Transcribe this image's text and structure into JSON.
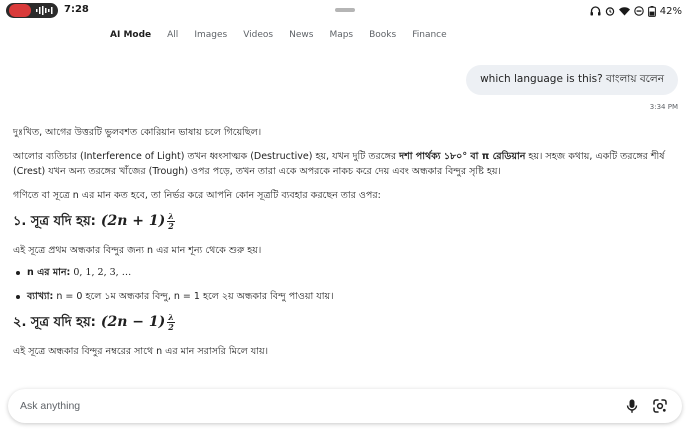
{
  "status": {
    "time": "7:28",
    "battery": "42%",
    "icons": [
      "screen-record-icon",
      "headphones-icon",
      "alarm-icon",
      "wifi-icon",
      "do-not-disturb-icon",
      "battery-icon"
    ]
  },
  "nav": {
    "tabs": [
      {
        "label": "AI Mode",
        "active": true
      },
      {
        "label": "All"
      },
      {
        "label": "Images"
      },
      {
        "label": "Videos"
      },
      {
        "label": "News"
      },
      {
        "label": "Maps"
      },
      {
        "label": "Books"
      },
      {
        "label": "Finance"
      }
    ]
  },
  "conversation": {
    "user_message": "which language is this? বাংলায় বলেন",
    "user_time": "3:34 PM",
    "answer": {
      "p1": "দুঃখিত, আগের উত্তরটি ভুলবশত কোরিয়ান ভাষায় চলে গিয়েছিল।",
      "p2_a": "আলোর ব্যতিচার (Interference of Light) তখন ধ্বংসাত্মক (Destructive) হয়, যখন দুটি তরঙ্গের ",
      "p2_bold": "দশা পার্থক্য ১৮০° বা π রেডিয়ান",
      "p2_b": " হয়। সহজ কথায়, একটি তরঙ্গের শীর্ষ (Crest) যখন অন্য তরঙ্গের খাঁজের (Trough) ওপর পড়ে, তখন তারা একে অপরকে নাকচ করে দেয় এবং অন্ধকার বিন্দুর সৃষ্টি হয়।",
      "p3": "গণিতে বা সূত্রে n এর মান কত হবে, তা নির্ভর করে আপনি কোন সূত্রটি ব্যবহার করছেন তার ওপর:",
      "h1_text": "১. সূত্র যদি হয়:",
      "h1_math": "(2n + 1)",
      "h1_frac_num": "λ",
      "h1_frac_den": "2",
      "h1_desc": "এই সূত্রে প্রথম অন্ধকার বিন্দুর জন্য n এর মান শূন্য থেকে শুরু হয়।",
      "b1_label": "n এর মান:",
      "b1_value": "0, 1, 2, 3, …",
      "b2_label": "ব্যাখ্যা:",
      "b2_value": " n = 0 হলে ১ম অন্ধকার বিন্দু, n = 1 হলে ২য় অন্ধকার বিন্দু পাওয়া যায়।",
      "h2_text": "২. সূত্র যদি হয়:",
      "h2_math": "(2n − 1)",
      "h2_frac_num": "λ",
      "h2_frac_den": "2",
      "h2_desc": "এই সূত্রে অন্ধকার বিন্দুর নম্বরের সাথে n এর মান সরাসরি মিলে যায়।"
    }
  },
  "input": {
    "placeholder": "Ask anything",
    "icons": [
      "microphone-icon",
      "google-lens-icon"
    ]
  }
}
